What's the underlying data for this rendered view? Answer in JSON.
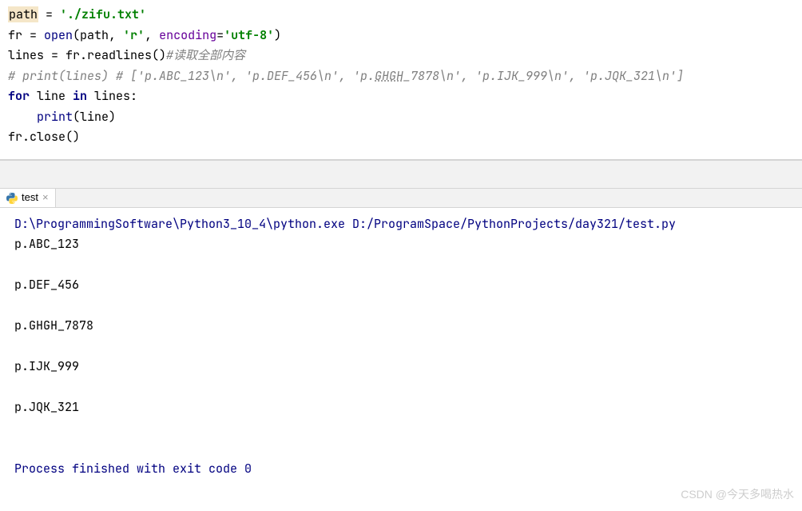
{
  "code": {
    "line1": {
      "var": "path",
      "rest": " = ",
      "str": "'./zifu.txt'"
    },
    "line2": {
      "p1": "fr = ",
      "builtin": "open",
      "p2": "(path, ",
      "str1": "'r'",
      "p3": ", ",
      "kwarg": "encoding",
      "p4": "=",
      "str2": "'utf-8'",
      "p5": ")"
    },
    "line3": {
      "p1": "lines = fr.readlines()",
      "comment": "#读取全部内容"
    },
    "line4": {
      "comment_a": "# print(lines) # ['p.ABC_123\\n', 'p.DEF_456\\n', 'p.",
      "comment_u": "GHGH",
      "comment_b": "_7878\\n', 'p.IJK_999\\n', 'p.JQK_321\\n']"
    },
    "line5": {
      "kw1": "for ",
      "p1": "line ",
      "kw2": "in ",
      "p2": "lines:"
    },
    "line6": {
      "indent": "    ",
      "builtin": "print",
      "p1": "(line)"
    },
    "line7": {
      "p1": "fr.close()"
    }
  },
  "tab": {
    "name": "test"
  },
  "console": {
    "cmd": "D:\\ProgrammingSoftware\\Python3_10_4\\python.exe D:/ProgramSpace/PythonProjects/day321/test.py",
    "out1": "p.ABC_123",
    "out2": "p.DEF_456",
    "out3": "p.GHGH_7878",
    "out4": "p.IJK_999",
    "out5": "p.JQK_321",
    "exit": "Process finished with exit code 0"
  },
  "watermark": "CSDN @今天多喝热水"
}
